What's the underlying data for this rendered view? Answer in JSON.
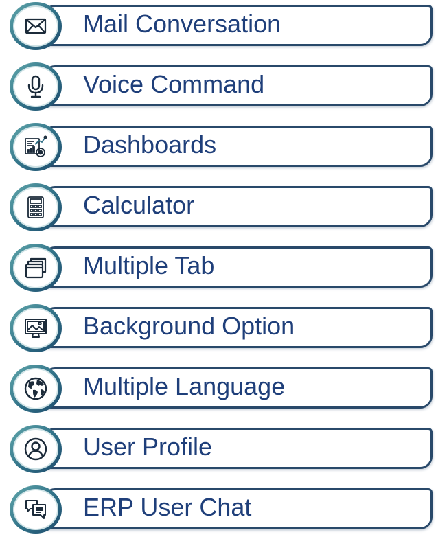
{
  "colors": {
    "label_text": "#1f3f7a",
    "border": "#29496a",
    "badge_ring_light": "#62a9ad",
    "badge_ring_dark": "#1e4a6c"
  },
  "items": [
    {
      "label": "Mail Conversation",
      "icon": "envelope-icon"
    },
    {
      "label": "Voice Command",
      "icon": "microphone-icon"
    },
    {
      "label": "Dashboards",
      "icon": "dashboard-icon"
    },
    {
      "label": "Calculator",
      "icon": "calculator-icon"
    },
    {
      "label": "Multiple Tab",
      "icon": "tabs-icon"
    },
    {
      "label": "Background Option",
      "icon": "monitor-image-icon"
    },
    {
      "label": "Multiple Language",
      "icon": "globe-icon"
    },
    {
      "label": "User Profile",
      "icon": "user-profile-icon"
    },
    {
      "label": "ERP User Chat",
      "icon": "chat-icon"
    }
  ]
}
